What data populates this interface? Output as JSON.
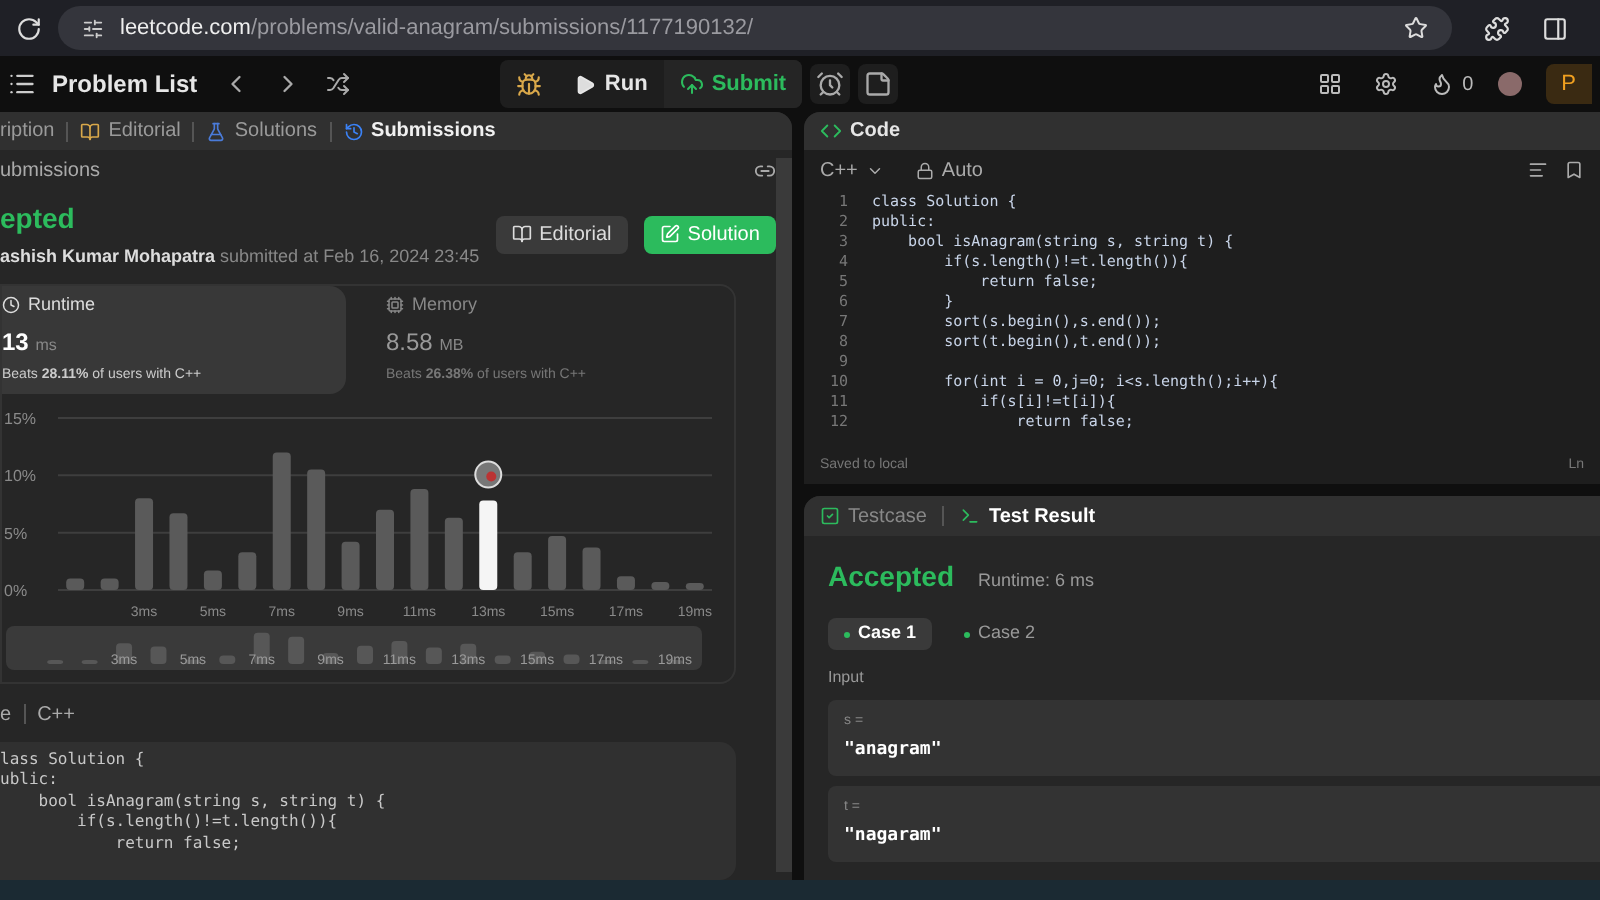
{
  "browser": {
    "url_host": "leetcode.com",
    "url_path": "/problems/valid-anagram/submissions/1177190132/"
  },
  "toolbar": {
    "problem_list": "Problem List",
    "run": "Run",
    "submit": "Submit",
    "streak": "0",
    "premium": "P"
  },
  "left_panel": {
    "tabs": [
      {
        "label": "ription",
        "selected": false
      },
      {
        "label": "Editorial",
        "selected": false
      },
      {
        "label": "Solutions",
        "selected": false
      },
      {
        "label": "Submissions",
        "selected": true
      }
    ],
    "subheader": "ubmissions",
    "status": "epted",
    "author": "ashish Kumar Mohapatra",
    "submitted": "submitted at Feb 16, 2024 23:45",
    "buttons": [
      {
        "label": "Editorial",
        "kind": "secondary"
      },
      {
        "label": "Solution",
        "kind": "primary"
      }
    ],
    "stats": [
      {
        "label": "Runtime",
        "value": "13",
        "unit": "ms",
        "beats": "Beats **28.11%** of users with C++",
        "selected": true
      },
      {
        "label": "Memory",
        "value": "8.58",
        "unit": "MB",
        "beats": "Beats **26.38%** of users with C++",
        "selected": false
      }
    ],
    "chart_data": {
      "type": "bar",
      "x": [
        1,
        2,
        3,
        4,
        5,
        6,
        7,
        8,
        9,
        10,
        11,
        12,
        13,
        14,
        15,
        16,
        17,
        18,
        19
      ],
      "values": [
        1,
        1,
        8,
        6.7,
        1.7,
        3.3,
        12,
        10.5,
        4.2,
        7,
        8.8,
        6.3,
        7.8,
        3.3,
        4.7,
        3.7,
        1.2,
        0.7,
        0.6
      ],
      "xticks": [
        {
          "value": 3,
          "label": "3ms"
        },
        {
          "value": 5,
          "label": "5ms"
        },
        {
          "value": 7,
          "label": "7ms"
        },
        {
          "value": 9,
          "label": "9ms"
        },
        {
          "value": 11,
          "label": "11ms"
        },
        {
          "value": 13,
          "label": "13ms"
        },
        {
          "value": 15,
          "label": "15ms"
        },
        {
          "value": 17,
          "label": "17ms"
        },
        {
          "value": 19,
          "label": "19ms"
        }
      ],
      "yticks": [
        {
          "value": 15,
          "label": "15%"
        },
        {
          "value": 10,
          "label": "10%"
        },
        {
          "value": 5,
          "label": "5%"
        },
        {
          "value": 0,
          "label": "0%"
        }
      ],
      "xlim": [
        0.5,
        19.5
      ],
      "ylim": [
        0,
        15
      ]
    },
    "overview_labels": [
      "3ms",
      "5ms",
      "7ms",
      "9ms",
      "11ms",
      "13ms",
      "15ms",
      "17ms",
      "19ms"
    ],
    "language": [
      "e",
      "C++"
    ],
    "code": [
      "lass Solution {",
      "ublic:",
      "    bool isAnagram(string s, string t) {",
      "        if(s.length()!=t.length()){",
      "            return false;"
    ]
  },
  "editor": {
    "title": "Code",
    "language": "C++",
    "mode": "Auto",
    "lines": [
      {
        "n": "1",
        "text": "class Solution {"
      },
      {
        "n": "2",
        "text": "public:"
      },
      {
        "n": "3",
        "text": "    bool isAnagram(string s, string t) {"
      },
      {
        "n": "4",
        "text": "        if(s.length()!=t.length()){"
      },
      {
        "n": "5",
        "text": "            return false;"
      },
      {
        "n": "6",
        "text": "        }"
      },
      {
        "n": "7",
        "text": "        sort(s.begin(),s.end());"
      },
      {
        "n": "8",
        "text": "        sort(t.begin(),t.end());"
      },
      {
        "n": "9"
      },
      {
        "n": "10",
        "text": "        for(int i = 0,j=0; i<s.length();i++){"
      },
      {
        "n": "11",
        "text": "            if(s[i]!=t[i]){"
      },
      {
        "n": "12",
        "text": "                return false;"
      }
    ],
    "saved": "Saved to local",
    "cursor": "Ln"
  },
  "result": {
    "tabs": [
      {
        "label": "Testcase",
        "selected": false
      },
      {
        "label": "Test Result",
        "selected": true
      }
    ],
    "status": "Accepted",
    "runtime": "Runtime: 6 ms",
    "cases": [
      {
        "label": "Case 1",
        "selected": true
      },
      {
        "label": "Case 2",
        "selected": false
      }
    ],
    "input_label": "Input",
    "inputs": [
      {
        "name": "s =",
        "value": "\"anagram\""
      },
      {
        "name": "t =",
        "value": "\"nagaram\""
      }
    ]
  }
}
